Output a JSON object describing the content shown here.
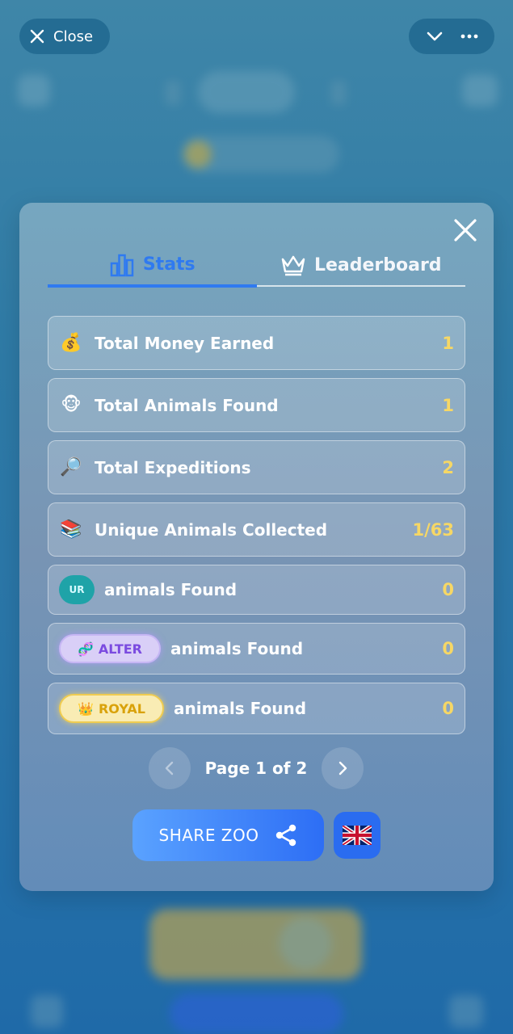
{
  "topbar": {
    "close_label": "Close"
  },
  "tabs": [
    {
      "label": "Stats",
      "icon": "bar-chart-icon",
      "active": true
    },
    {
      "label": "Leaderboard",
      "icon": "crown-icon",
      "active": false
    }
  ],
  "stats": [
    {
      "icon": "money-bag-icon",
      "emoji": "💰",
      "label": "Total Money Earned",
      "value": "1"
    },
    {
      "icon": "monkey-icon",
      "emoji": "🐵",
      "label": "Total Animals Found",
      "value": "1"
    },
    {
      "icon": "magnifier-icon",
      "emoji": "🔎",
      "label": "Total Expeditions",
      "value": "2"
    },
    {
      "icon": "books-icon",
      "emoji": "📚",
      "label": "Unique Animals Collected",
      "value": "1/63"
    }
  ],
  "rarity_rows": [
    {
      "badge": "UR",
      "badge_emoji": "",
      "label": "animals Found",
      "value": "0"
    },
    {
      "badge": "ALTER",
      "badge_emoji": "🧬",
      "label": "animals Found",
      "value": "0"
    },
    {
      "badge": "ROYAL",
      "badge_emoji": "👑",
      "label": "animals Found",
      "value": "0"
    }
  ],
  "pager": {
    "text": "Page 1 of 2"
  },
  "share": {
    "label": "SHARE ZOO"
  },
  "colors": {
    "accent": "#2f7af0",
    "value": "#f6d765"
  }
}
